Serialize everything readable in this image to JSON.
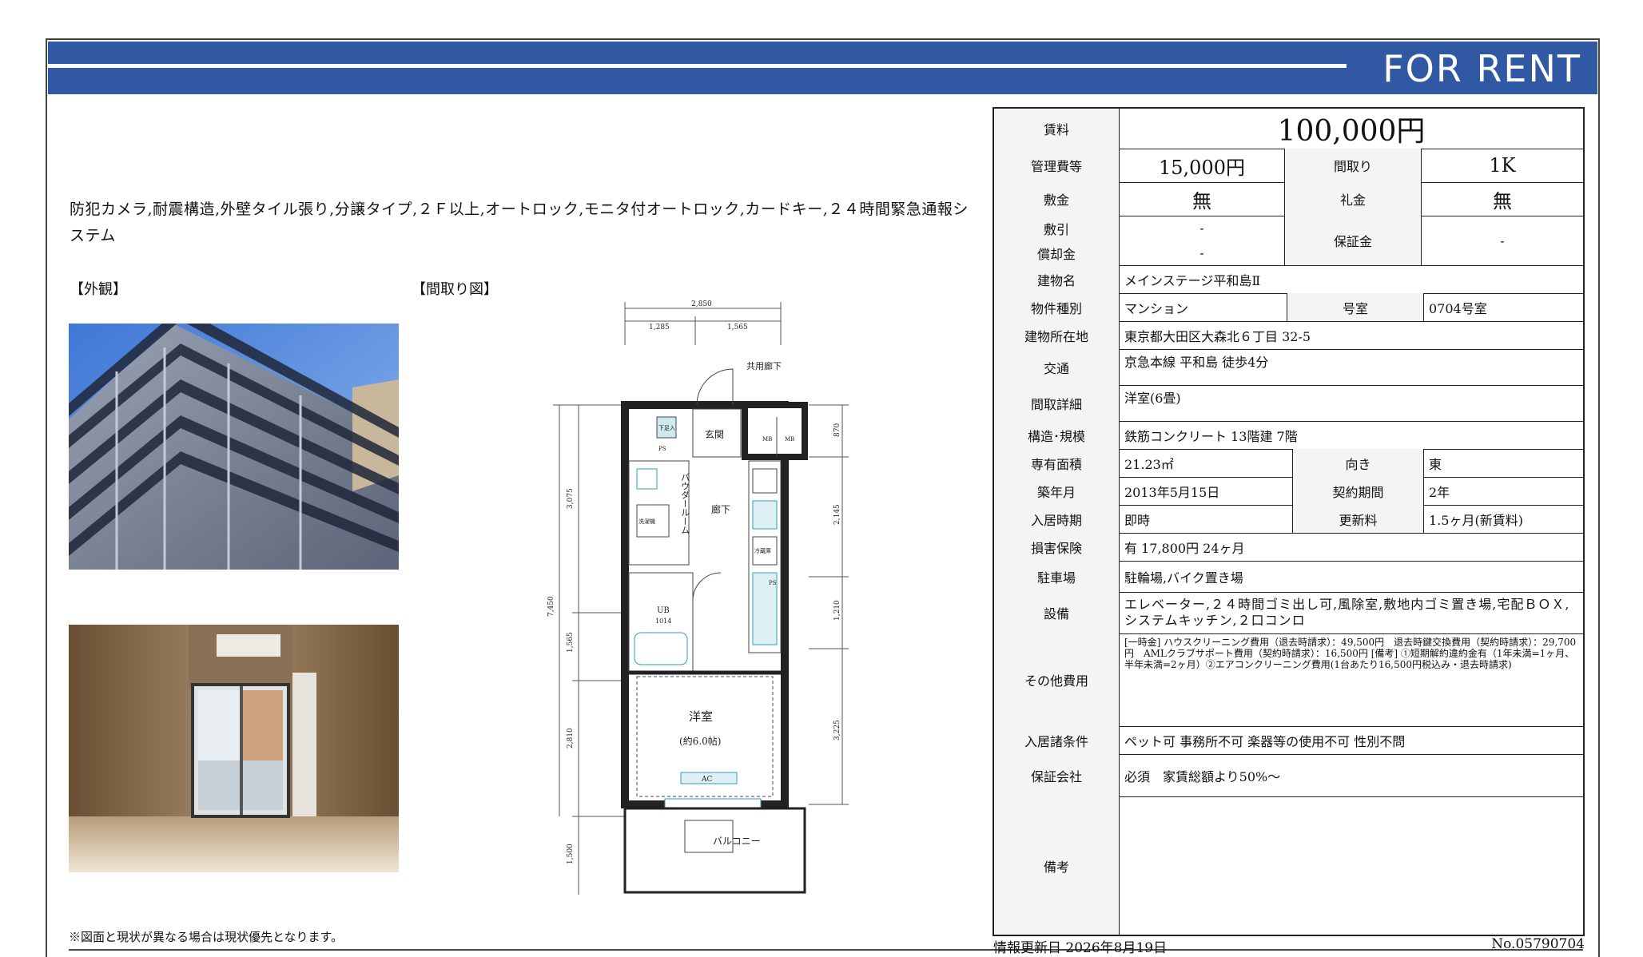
{
  "banner": {
    "title": "FOR RENT"
  },
  "features": "防犯カメラ,耐震構造,外壁タイル張り,分譲タイプ,２Ｆ以上,オートロック,モニタ付オートロック,カードキー,２４時間緊急通報システム",
  "sections": {
    "exterior": "【外観】",
    "floorplan": "【間取り図】"
  },
  "floorplan": {
    "dims": [
      "2,850",
      "1,285",
      "1,565",
      "870",
      "3,075",
      "2,145",
      "1,565",
      "1,210",
      "7,450",
      "2,810",
      "3,225",
      "1,500"
    ],
    "rooms": {
      "hall": "共用廊下",
      "entrance": "玄関",
      "powder": "パウダールーム",
      "corridor": "廊下",
      "ub": "UB",
      "ub_size": "1014",
      "western": "洋室",
      "western_size": "(約6.0帖)",
      "balcony": "バルコニー",
      "ac": "AC",
      "ps": "PS",
      "mb1": "MB",
      "mb2": "MB",
      "washer": "洗濯機",
      "fridge": "冷蔵庫",
      "shoes": "下足入"
    }
  },
  "note": "※図面と現状が異なる場合は現状優先となります。",
  "table": {
    "rent_label": "賃料",
    "rent": "100,000円",
    "mgmt_label": "管理費等",
    "mgmt": "15,000円",
    "layout_label": "間取り",
    "layout": "1K",
    "deposit_label": "敷金",
    "deposit": "無",
    "keymoney_label": "礼金",
    "keymoney": "無",
    "shikibiki_label": "敷引",
    "shikibiki": "-",
    "shokyaku_label": "償却金",
    "shokyaku": "-",
    "guarantee_label": "保証金",
    "guarantee": "-",
    "building_label": "建物名",
    "building": "メインステージ平和島Ⅱ",
    "type_label": "物件種別",
    "type": "マンション",
    "room_label": "号室",
    "room": "0704号室",
    "address_label": "建物所在地",
    "address": "東京都大田区大森北６丁目 32-5",
    "traffic_label": "交通",
    "traffic": "京急本線 平和島 徒歩4分",
    "detail_label": "間取詳細",
    "detail": "洋室(6畳)",
    "structure_label": "構造･規模",
    "structure": "鉄筋コンクリート 13階建 7階",
    "area_label": "専有面積",
    "area": "21.23㎡",
    "direction_label": "向き",
    "direction": "東",
    "built_label": "築年月",
    "built": "2013年5月15日",
    "term_label": "契約期間",
    "term": "2年",
    "movein_label": "入居時期",
    "movein": "即時",
    "renew_label": "更新料",
    "renew": "1.5ヶ月(新賃料)",
    "insurance_label": "損害保険",
    "insurance": "有 17,800円 24ヶ月",
    "parking_label": "駐車場",
    "parking": "駐輪場,バイク置き場",
    "equipment_label": "設備",
    "equipment": "エレベーター,２４時間ゴミ出し可,風除室,敷地内ゴミ置き場,宅配ＢＯＸ,システムキッチン,２口コンロ",
    "other_label": "その他費用",
    "other": "[一時金] ハウスクリーニング費用（退去時請求）：49,500円　退去時鍵交換費用（契約時請求）：29,700円　AMLクラブサポート費用（契約時請求）：16,500円 [備考] ①短期解約違約金有（1年未満=1ヶ月、半年未満=2ヶ月）②エアコンクリーニング費用(1台あたり16,500円税込み・退去時請求)",
    "conditions_label": "入居諸条件",
    "conditions": "ペット可 事務所不可 楽器等の使用不可 性別不問",
    "company_label": "保証会社",
    "company": "必須　家賃総額より50%～",
    "remarks_label": "備考",
    "remarks": ""
  },
  "footer": {
    "update": "情報更新日 2026年8月19日",
    "doc_no": "No.05790704"
  }
}
